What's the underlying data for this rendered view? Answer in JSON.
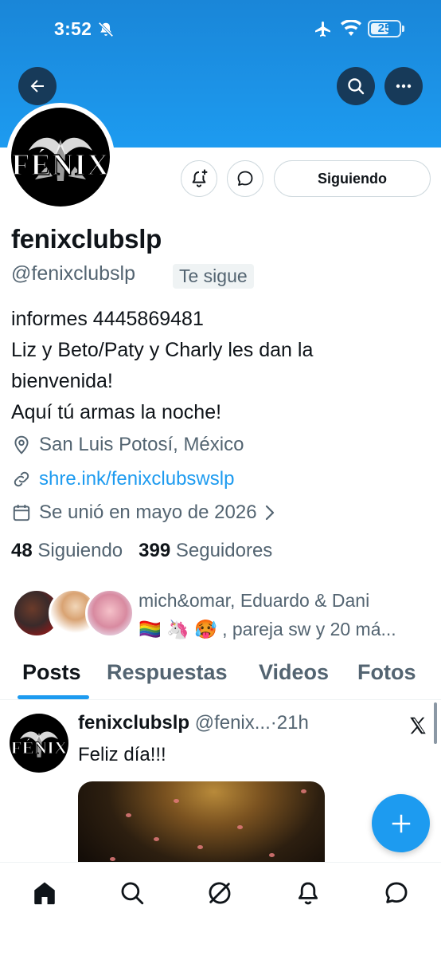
{
  "status_bar": {
    "time": "3:52",
    "battery": "25",
    "icons": [
      "bell-off-icon",
      "airplane-icon",
      "wifi-icon",
      "battery-icon"
    ]
  },
  "header": {
    "icons": [
      "back-arrow-icon",
      "search-icon",
      "more-icon"
    ]
  },
  "profile": {
    "avatar_text": "FÉNIX",
    "display_name": "fenixclubslp",
    "handle": "@fenixclubslp",
    "follows_you": "Te sigue",
    "follow_button": "Siguiendo",
    "bio": [
      "informes 4445869481",
      "Liz y Beto/Paty y Charly les dan la",
      "bienvenida!",
      "Aquí tú armas la noche!"
    ],
    "location": "San Luis Potosí, México",
    "link": "shre.ink/fenixclubswslp",
    "joined": "Se unió en mayo de 2026",
    "following_count": "48",
    "following_label": "Siguiendo",
    "followers_count": "399",
    "followers_label": "Seguidores",
    "mutuals_line1": "mich&omar, Eduardo & Dani",
    "mutuals_line2": "🏳️‍🌈 🦄 🥵 , pareja sw y 20 má..."
  },
  "tabs": [
    "Posts",
    "Respuestas",
    "Videos",
    "Fotos"
  ],
  "active_tab": "Posts",
  "post": {
    "name": "fenixclubslp",
    "handle": "@fenix...",
    "separator": "·",
    "time": "21h",
    "text": "Feliz día!!!"
  },
  "bottom_nav": [
    "home-icon",
    "search-icon",
    "grok-icon",
    "notifications-icon",
    "messages-icon"
  ],
  "colors": {
    "accent": "#1d9bf0",
    "banner": "#1a86d8",
    "secondary_text": "#536471",
    "primary_text": "#0f1419"
  }
}
